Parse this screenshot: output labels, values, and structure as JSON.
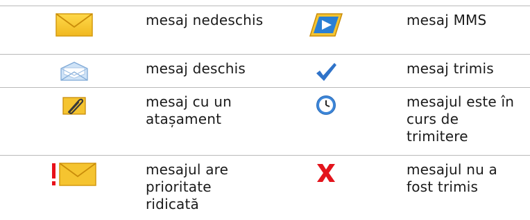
{
  "legend": {
    "rows": [
      {
        "left": {
          "icon": "envelope-closed-icon",
          "label": "mesaj nedeschis"
        },
        "right": {
          "icon": "mms-message-icon",
          "label": "mesaj MMS"
        }
      },
      {
        "left": {
          "icon": "envelope-open-icon",
          "label": "mesaj deschis"
        },
        "right": {
          "icon": "checkmark-icon",
          "label": "mesaj trimis"
        }
      },
      {
        "left": {
          "icon": "paperclip-attachment-icon",
          "label": "mesaj cu un atașament"
        },
        "right": {
          "icon": "clock-icon",
          "label": "mesajul este în curs de trimitere"
        }
      },
      {
        "left": {
          "icon": "high-priority-envelope-icon",
          "label": "mesajul are prioritate ridicată"
        },
        "right": {
          "icon": "red-x-icon",
          "label": "mesajul nu a fost trimis"
        }
      }
    ]
  },
  "colors": {
    "envelope_yellow": "#f5c430",
    "envelope_border": "#d49a10",
    "mms_blue": "#2a7fd4",
    "check_blue": "#2f73c9",
    "priority_red": "#e8101a",
    "x_red": "#e3141c",
    "divider": "#b9b9b9"
  }
}
